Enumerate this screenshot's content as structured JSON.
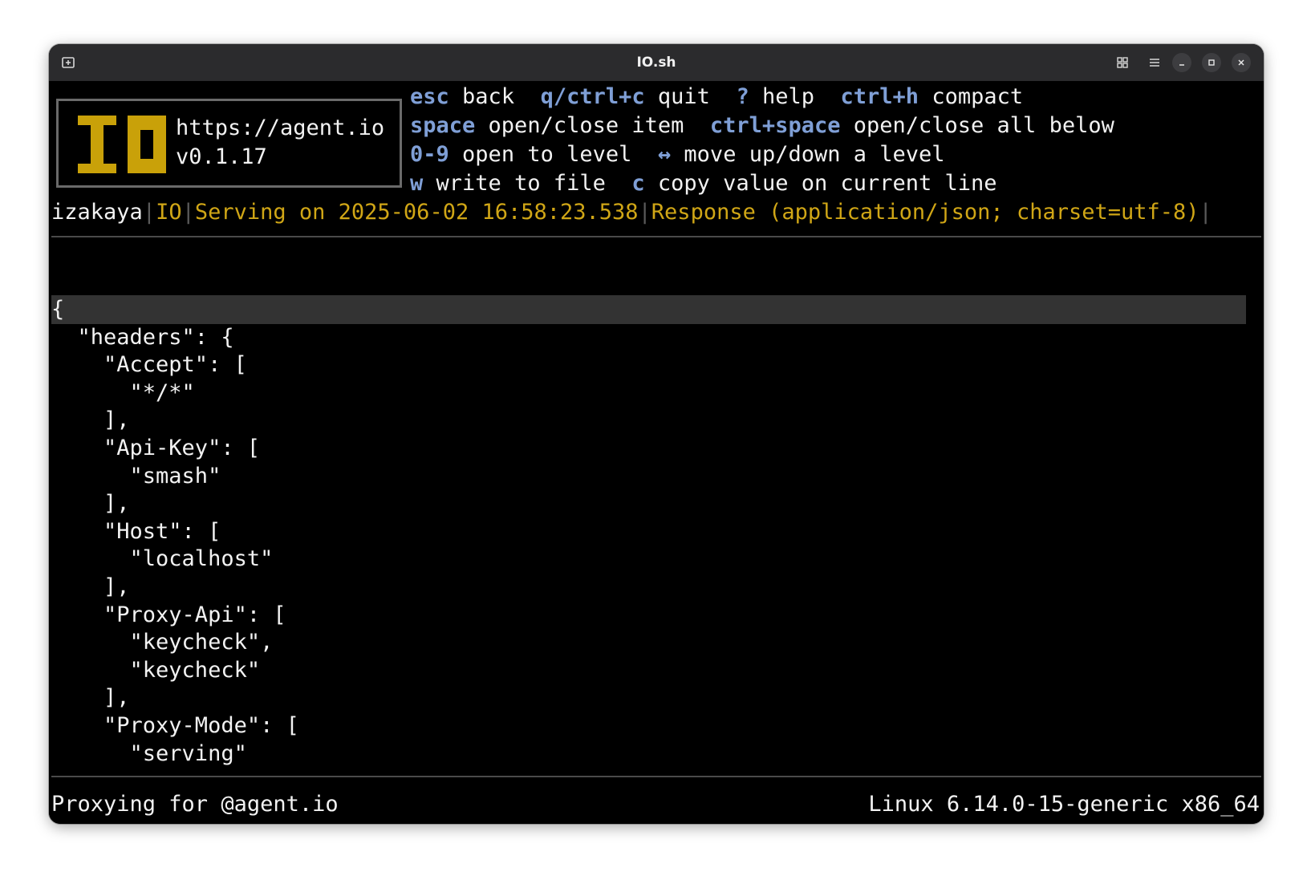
{
  "window": {
    "title": "IO.sh"
  },
  "logo": {
    "url": "https://agent.io",
    "version": "v0.1.17",
    "color": "#c9a109"
  },
  "help": {
    "row1": [
      {
        "key": "esc",
        "desc": "back"
      },
      {
        "key": "q/ctrl+c",
        "desc": "quit"
      },
      {
        "key": "?",
        "desc": "help"
      },
      {
        "key": "ctrl+h",
        "desc": "compact"
      }
    ],
    "row2": [
      {
        "key": "space",
        "desc": "open/close item"
      },
      {
        "key": "ctrl+space",
        "desc": "open/close all below"
      }
    ],
    "row3": [
      {
        "key": "0-9",
        "desc": "open to level"
      },
      {
        "key": "↔",
        "desc": "move up/down a level"
      }
    ],
    "row4": [
      {
        "key": "w",
        "desc": "write to file"
      },
      {
        "key": "c",
        "desc": "copy value on current line"
      }
    ]
  },
  "status": {
    "name": "izakaya",
    "io": "IO",
    "serving": "Serving on 2025-06-02 16:58:23.538",
    "response": "Response (application/json; charset=utf-8)",
    "separator": "|"
  },
  "json_view": {
    "lines": [
      "{",
      "  \"headers\": {",
      "    \"Accept\": [",
      "      \"*/*\"",
      "    ],",
      "    \"Api-Key\": [",
      "      \"smash\"",
      "    ],",
      "    \"Host\": [",
      "      \"localhost\"",
      "    ],",
      "    \"Proxy-Api\": [",
      "      \"keycheck\",",
      "      \"keycheck\"",
      "    ],",
      "    \"Proxy-Mode\": [",
      "      \"serving\""
    ],
    "selected_line": 0
  },
  "footer": {
    "left": "Proxying for @agent.io",
    "right": "Linux 6.14.0-15-generic x86_64"
  },
  "colors": {
    "key_blue": "#7f9fd6",
    "gold": "#d0a616",
    "background": "#000000",
    "titlebar": "#2b2b2d"
  }
}
